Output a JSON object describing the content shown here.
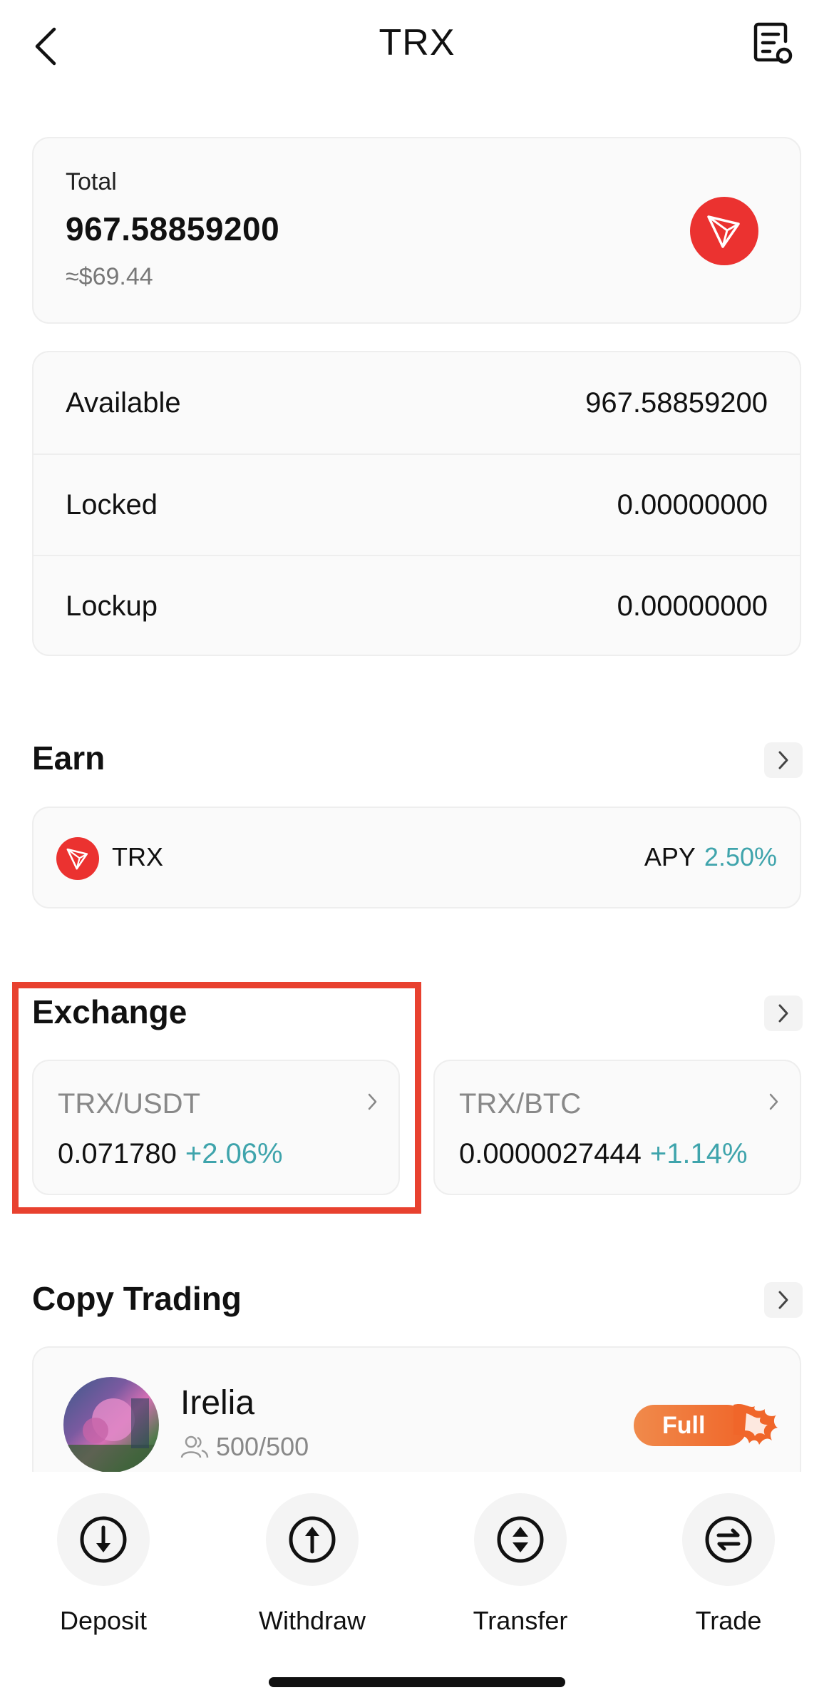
{
  "header": {
    "title": "TRX"
  },
  "total": {
    "label": "Total",
    "value": "967.58859200",
    "usd": "≈$69.44"
  },
  "balances": [
    {
      "label": "Available",
      "value": "967.58859200"
    },
    {
      "label": "Locked",
      "value": "0.00000000"
    },
    {
      "label": "Lockup",
      "value": "0.00000000"
    }
  ],
  "earn": {
    "title": "Earn",
    "coin": "TRX",
    "apy_label": "APY",
    "apy_value": "2.50%"
  },
  "exchange": {
    "title": "Exchange",
    "pairs": [
      {
        "name": "TRX/USDT",
        "price": "0.071780",
        "change": "+2.06%"
      },
      {
        "name": "TRX/BTC",
        "price": "0.0000027444",
        "change": "+1.14%"
      }
    ]
  },
  "copy_trading": {
    "title": "Copy Trading",
    "trader": {
      "name": "Irelia",
      "followers": "500/500",
      "badge": "Full"
    }
  },
  "actions": [
    {
      "label": "Deposit",
      "icon": "deposit-icon"
    },
    {
      "label": "Withdraw",
      "icon": "withdraw-icon"
    },
    {
      "label": "Transfer",
      "icon": "transfer-icon"
    },
    {
      "label": "Trade",
      "icon": "trade-icon"
    }
  ],
  "colors": {
    "accent": "#3fa4ac",
    "tron_red": "#eb3230",
    "highlight": "#e8412f",
    "badge_orange": "#f0662a"
  }
}
